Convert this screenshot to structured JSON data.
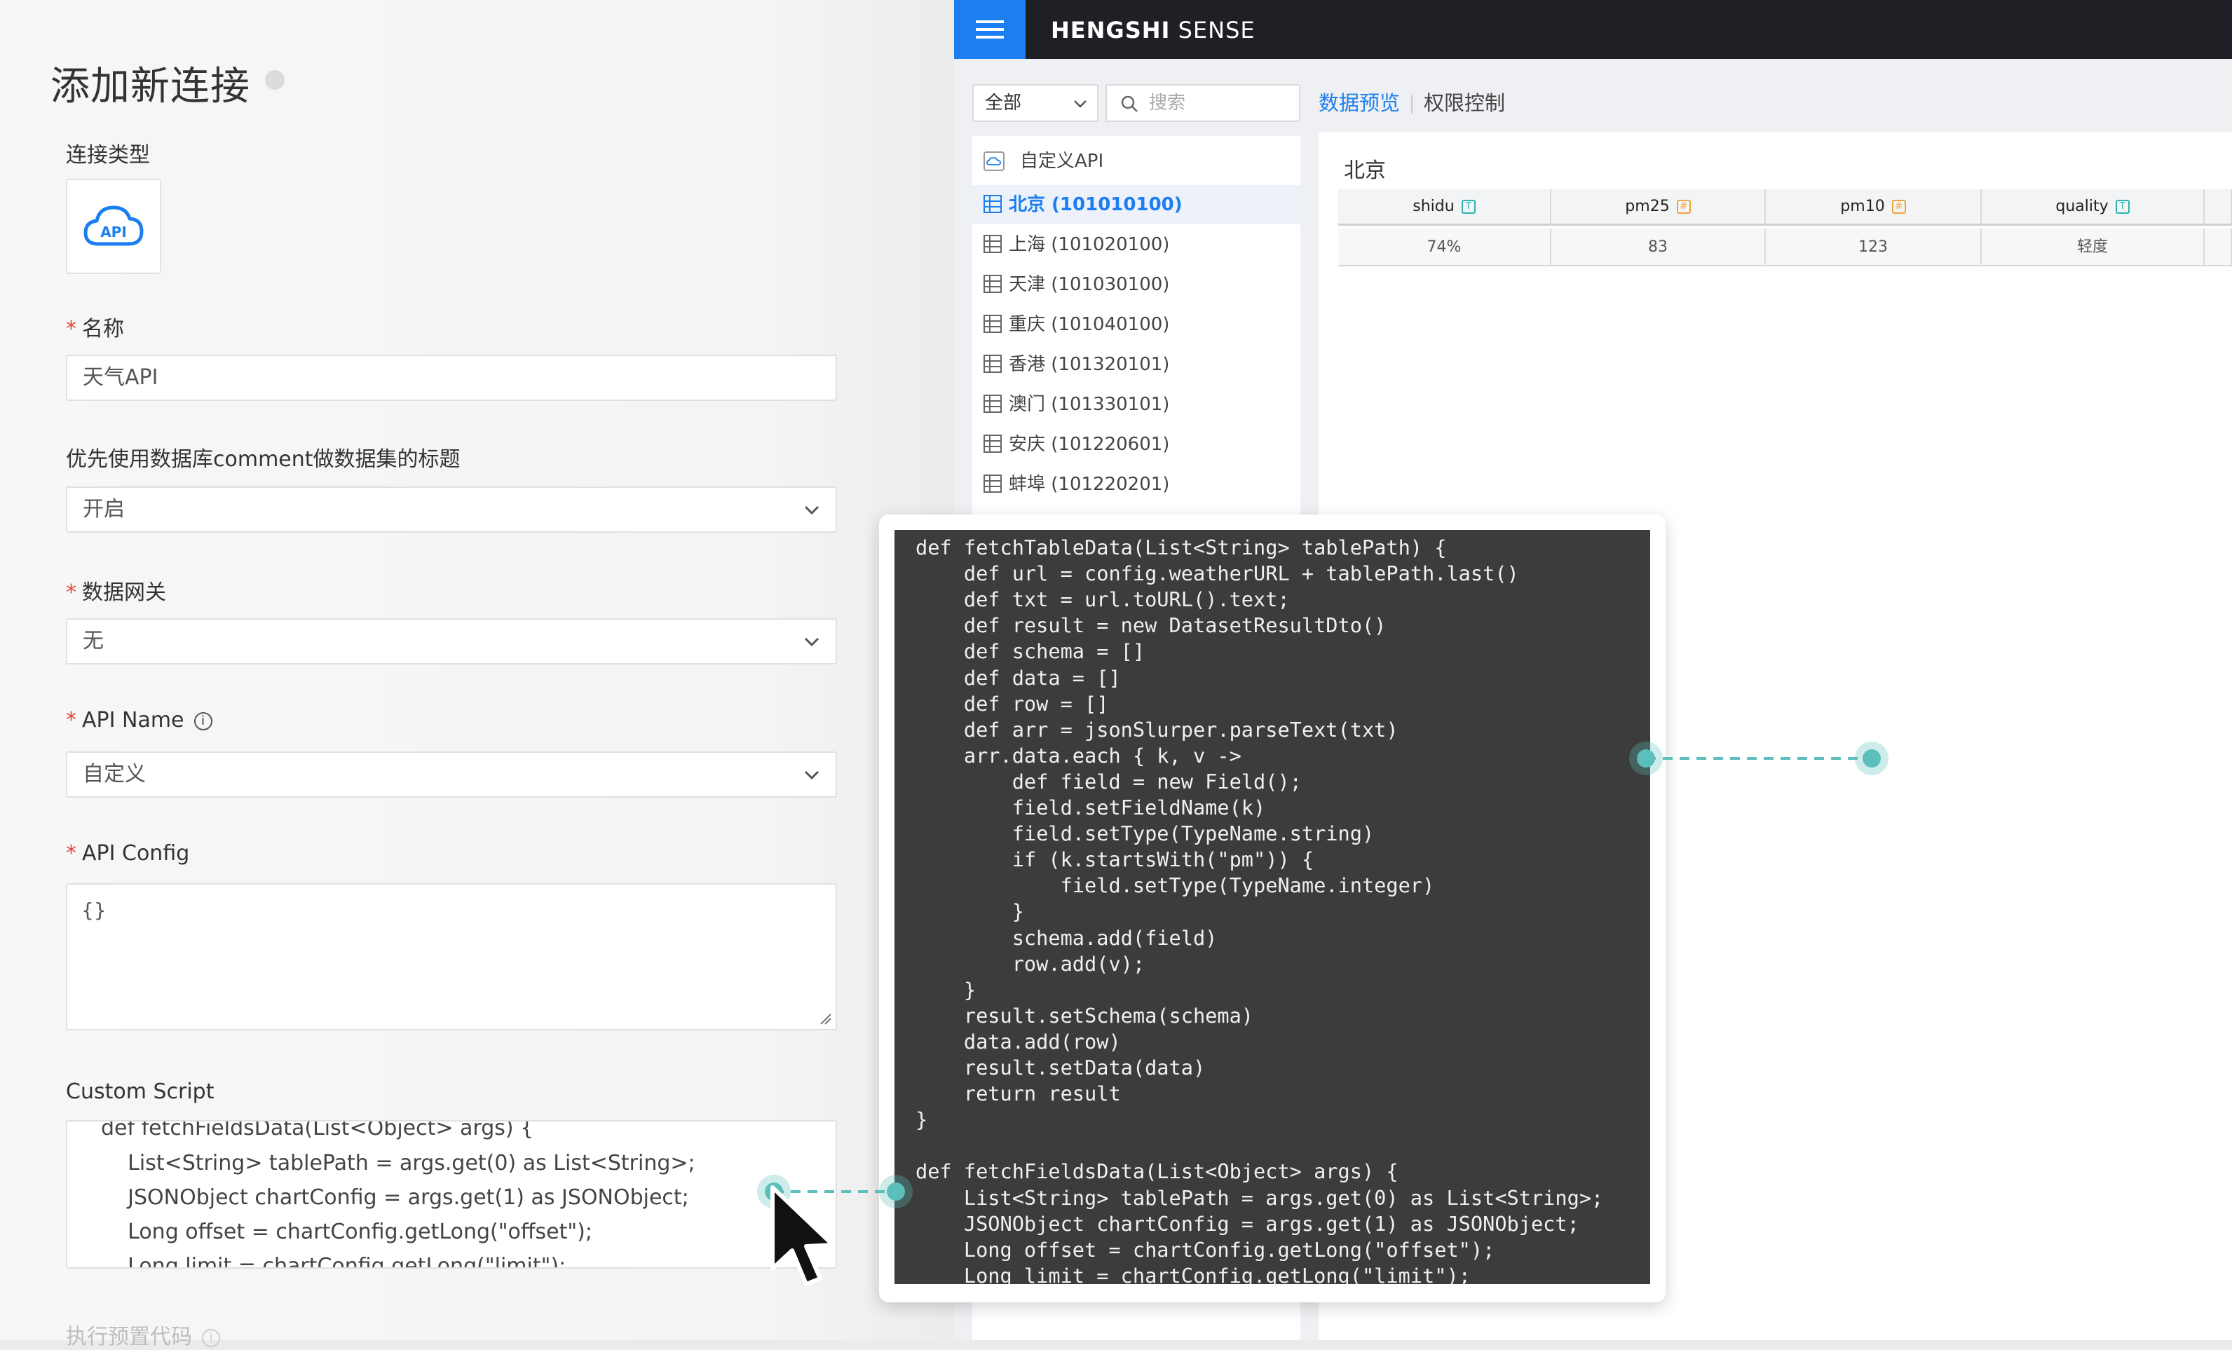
{
  "form": {
    "title": "添加新连接",
    "conn_type_label": "连接类型",
    "conn_type_icon_text": "API",
    "required_mark": "*",
    "name_label": "名称",
    "name_value": "天气API",
    "comment_label": "优先使用数据库comment做数据集的标题",
    "comment_value": "开启",
    "gateway_label": "数据网关",
    "gateway_value": "无",
    "api_name_label": "API Name",
    "api_name_info": "i",
    "api_name_value": "自定义",
    "api_config_label": "API Config",
    "api_config_value": "{}",
    "custom_script_label": "Custom Script",
    "custom_script_lines": [
      "def fetchFieldsData(List<Object> args) {",
      "    List<String> tablePath = args.get(0) as List<String>;",
      "    JSONObject chartConfig = args.get(1) as JSONObject;",
      "    Long offset = chartConfig.getLong(\"offset\");",
      "    Long limit = chartConfig.getLong(\"limit\");"
    ],
    "preset_label": "执行预置代码"
  },
  "app": {
    "brand_bold": "HENGSHI",
    "brand_rest": " SENSE",
    "filter_value": "全部",
    "search_placeholder": "搜索",
    "tab_preview": "数据预览",
    "tab_permissions": "权限控制",
    "list_items": [
      {
        "label": "自定义API",
        "kind": "api"
      },
      {
        "label": "北京 (101010100)",
        "kind": "table",
        "active": true
      },
      {
        "label": "上海 (101020100)",
        "kind": "table"
      },
      {
        "label": "天津 (101030100)",
        "kind": "table"
      },
      {
        "label": "重庆 (101040100)",
        "kind": "table"
      },
      {
        "label": "香港 (101320101)",
        "kind": "table"
      },
      {
        "label": "澳门 (101330101)",
        "kind": "table"
      },
      {
        "label": "安庆 (101220601)",
        "kind": "table"
      },
      {
        "label": "蚌埠 (101220201)",
        "kind": "table"
      }
    ],
    "preview_title": "北京",
    "columns": [
      {
        "name": "shidu",
        "type": "T"
      },
      {
        "name": "pm25",
        "type": "#"
      },
      {
        "name": "pm10",
        "type": "#"
      },
      {
        "name": "quality",
        "type": "T"
      }
    ],
    "row": [
      "74%",
      "83",
      "123",
      "轻度"
    ]
  },
  "code_lines": [
    "def fetchTableData(List<String> tablePath) {",
    "    def url = config.weatherURL + tablePath.last()",
    "    def txt = url.toURL().text;",
    "    def result = new DatasetResultDto()",
    "    def schema = []",
    "    def data = []",
    "    def row = []",
    "    def arr = jsonSlurper.parseText(txt)",
    "    arr.data.each { k, v ->",
    "        def field = new Field();",
    "        field.setFieldName(k)",
    "        field.setType(TypeName.string)",
    "        if (k.startsWith(\"pm\")) {",
    "            field.setType(TypeName.integer)",
    "        }",
    "        schema.add(field)",
    "        row.add(v);",
    "    }",
    "    result.setSchema(schema)",
    "    data.add(row)",
    "    result.setData(data)",
    "    return result",
    "}",
    "",
    "def fetchFieldsData(List<Object> args) {",
    "    List<String> tablePath = args.get(0) as List<String>;",
    "    JSONObject chartConfig = args.get(1) as JSONObject;",
    "    Long offset = chartConfig.getLong(\"offset\");",
    "    Long limit = chartConfig.getLong(\"limit\");"
  ],
  "colors": {
    "accent": "#1c7ef0",
    "topbar": "#1f1f26",
    "code_bg": "#3c3c3c",
    "connector": "#5bbfbb",
    "required": "#e0463b"
  }
}
